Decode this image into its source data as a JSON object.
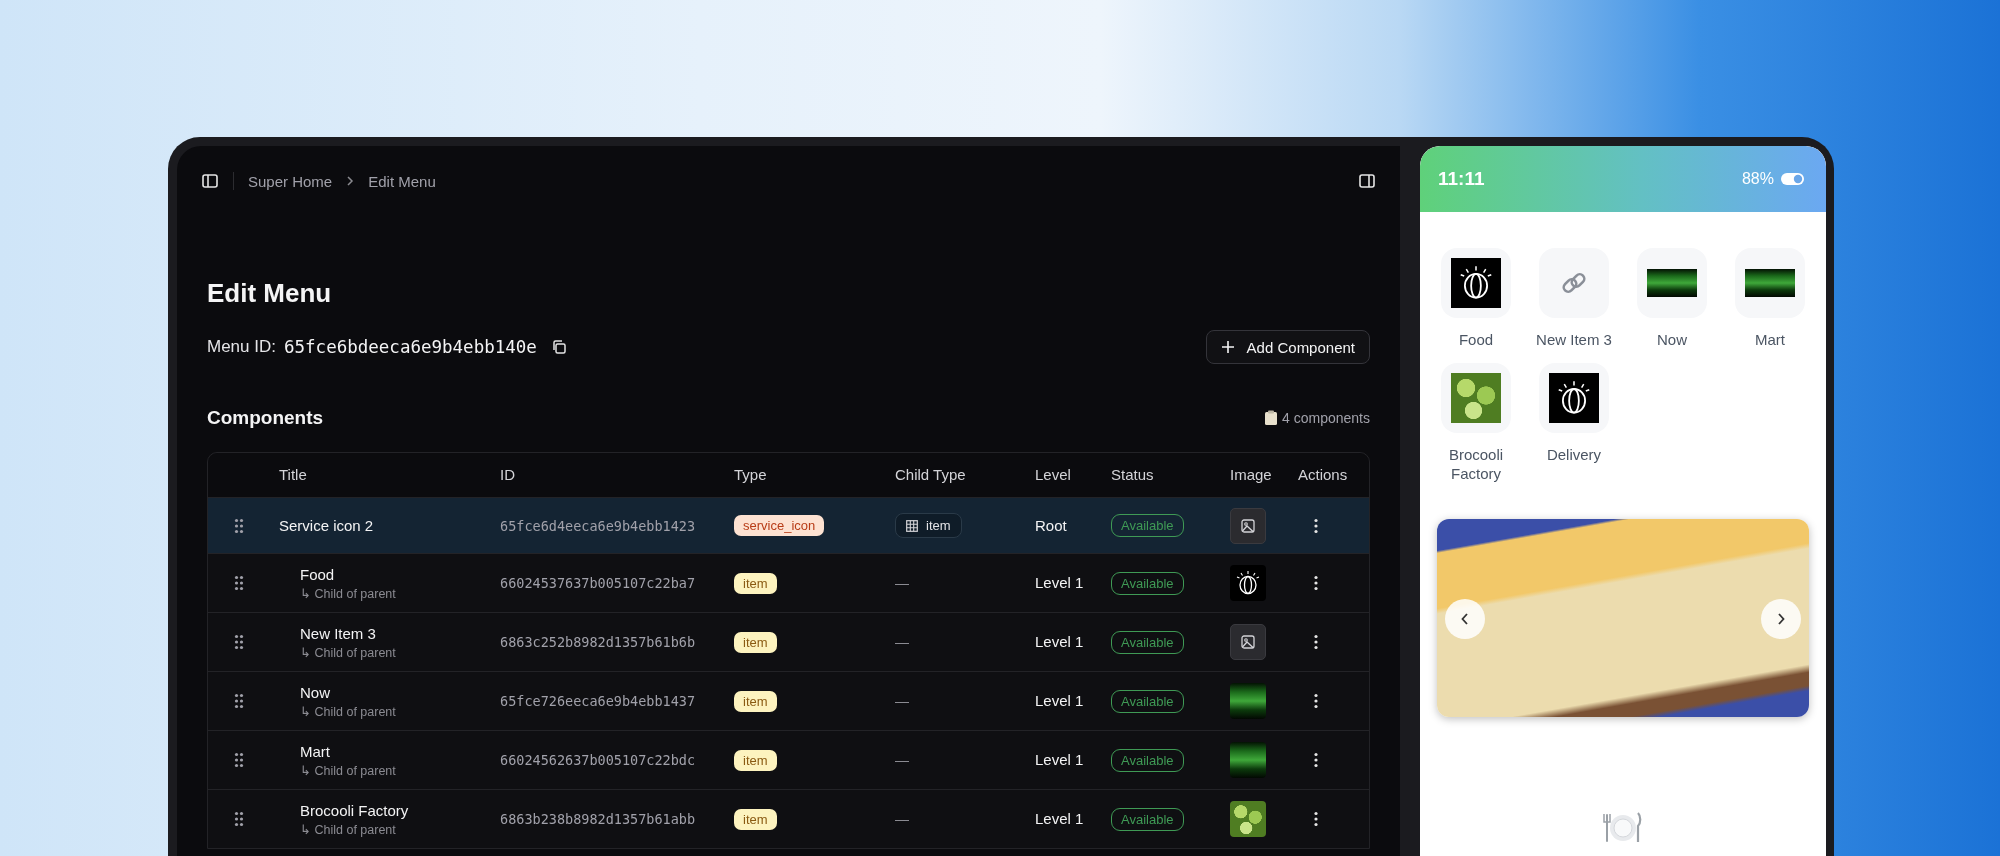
{
  "topbar": {
    "breadcrumbs": [
      "Super Home",
      "Edit Menu"
    ]
  },
  "page": {
    "title": "Edit Menu",
    "menu_id_label": "Menu ID:",
    "menu_id": "65fce6bdeeca6e9b4ebb140e",
    "add_button": "Add Component"
  },
  "components": {
    "heading": "Components",
    "count": "4 components"
  },
  "table": {
    "columns": [
      "Title",
      "ID",
      "Type",
      "Child Type",
      "Level",
      "Status",
      "Image",
      "Actions"
    ],
    "rows": [
      {
        "kind": "root",
        "selected": true,
        "title": "Service icon 2",
        "id": "65fce6d4eeca6e9b4ebb1423",
        "type": "service_icon",
        "child_type": "item",
        "level": "Root",
        "status": "Available",
        "image": {
          "kind": "placeholder"
        }
      },
      {
        "kind": "child",
        "selected": false,
        "title": "Food",
        "subtitle": "↳ Child of parent",
        "id": "66024537637b005107c22ba7",
        "type": "item",
        "child_type": "—",
        "level": "Level 1",
        "status": "Available",
        "image": {
          "kind": "logo"
        }
      },
      {
        "kind": "child",
        "selected": false,
        "title": "New Item 3",
        "subtitle": "↳ Child of parent",
        "id": "6863c252b8982d1357b61b6b",
        "type": "item",
        "child_type": "—",
        "level": "Level 1",
        "status": "Available",
        "image": {
          "kind": "placeholder"
        }
      },
      {
        "kind": "child",
        "selected": false,
        "title": "Now",
        "subtitle": "↳ Child of parent",
        "id": "65fce726eeca6e9b4ebb1437",
        "type": "item",
        "child_type": "—",
        "level": "Level 1",
        "status": "Available",
        "image": {
          "kind": "green"
        }
      },
      {
        "kind": "child",
        "selected": false,
        "title": "Mart",
        "subtitle": "↳ Child of parent",
        "id": "66024562637b005107c22bdc",
        "type": "item",
        "child_type": "—",
        "level": "Level 1",
        "status": "Available",
        "image": {
          "kind": "green"
        }
      },
      {
        "kind": "child",
        "selected": false,
        "title": "Brocooli Factory",
        "subtitle": "↳ Child of parent",
        "id": "6863b238b8982d1357b61abb",
        "type": "item",
        "child_type": "—",
        "level": "Level 1",
        "status": "Available",
        "image": {
          "kind": "broccoli"
        }
      }
    ]
  },
  "phone": {
    "time": "11:11",
    "battery": "88%",
    "tiles": [
      {
        "label": "Food",
        "image": {
          "kind": "logo"
        }
      },
      {
        "label": "New Item 3",
        "image": {
          "kind": "link"
        }
      },
      {
        "label": "Now",
        "image": {
          "kind": "green"
        }
      },
      {
        "label": "Mart",
        "image": {
          "kind": "green"
        }
      },
      {
        "label": "Brocooli Factory",
        "image": {
          "kind": "broccoli"
        }
      },
      {
        "label": "Delivery",
        "image": {
          "kind": "logo"
        }
      }
    ]
  }
}
